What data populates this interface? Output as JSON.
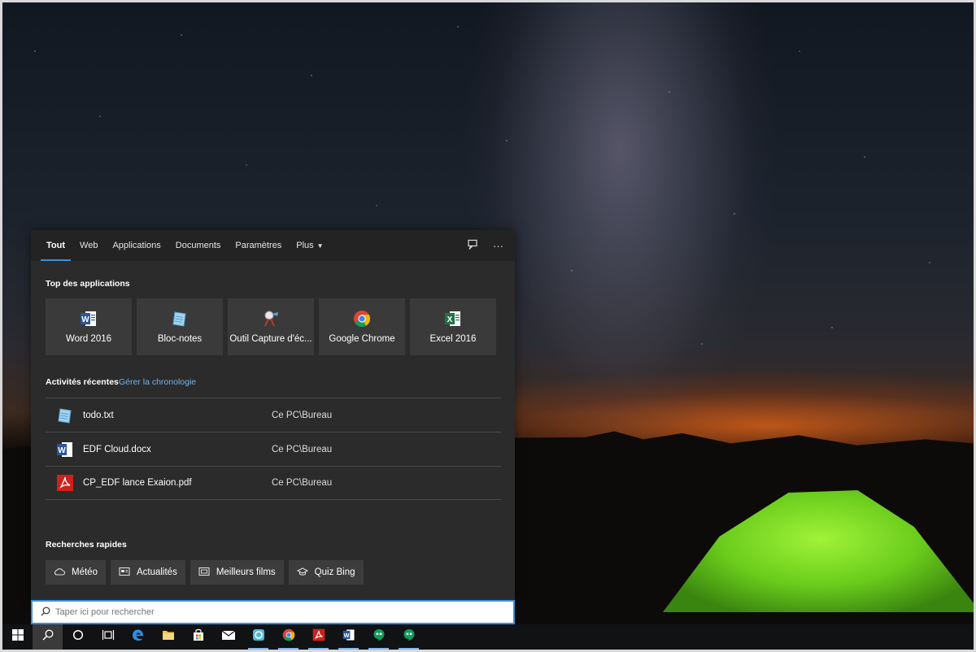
{
  "search": {
    "tabs": [
      {
        "label": "Tout"
      },
      {
        "label": "Web"
      },
      {
        "label": "Applications"
      },
      {
        "label": "Documents"
      },
      {
        "label": "Paramètres"
      },
      {
        "label": "Plus"
      }
    ],
    "top_apps_title": "Top des applications",
    "top_apps": [
      {
        "label": "Word 2016",
        "icon": "word-icon"
      },
      {
        "label": "Bloc-notes",
        "icon": "notepad-icon"
      },
      {
        "label": "Outil Capture d'éc...",
        "icon": "snipping-tool-icon"
      },
      {
        "label": "Google Chrome",
        "icon": "chrome-icon"
      },
      {
        "label": "Excel 2016",
        "icon": "excel-icon"
      }
    ],
    "recent_title": "Activités récentes",
    "recent_link": "Gérer la chronologie",
    "recent": [
      {
        "name": "todo.txt",
        "location": "Ce PC\\Bureau",
        "icon": "notepad-icon"
      },
      {
        "name": "EDF Cloud.docx",
        "location": "Ce PC\\Bureau",
        "icon": "word-icon"
      },
      {
        "name": "CP_EDF lance Exaion.pdf",
        "location": "Ce PC\\Bureau",
        "icon": "pdf-icon"
      }
    ],
    "quick_title": "Recherches rapides",
    "quick": [
      {
        "label": "Météo",
        "icon": "weather-icon"
      },
      {
        "label": "Actualités",
        "icon": "news-icon"
      },
      {
        "label": "Meilleurs films",
        "icon": "movie-icon"
      },
      {
        "label": "Quiz Bing",
        "icon": "quiz-icon"
      }
    ],
    "placeholder": "Taper ici pour rechercher"
  },
  "taskbar": {
    "items": [
      "start-icon",
      "search-icon",
      "cortana-icon",
      "task-view-icon",
      "edge-icon",
      "file-explorer-icon",
      "store-icon",
      "mail-icon",
      "app-icon",
      "chrome-icon",
      "acrobat-icon",
      "word-icon",
      "hangouts-icon",
      "hangouts-icon"
    ]
  },
  "colors": {
    "accent": "#3b8fd8",
    "panel_bg": "#2b2b2b",
    "tile_bg": "#3a3a3a",
    "link": "#6fb4ef"
  }
}
